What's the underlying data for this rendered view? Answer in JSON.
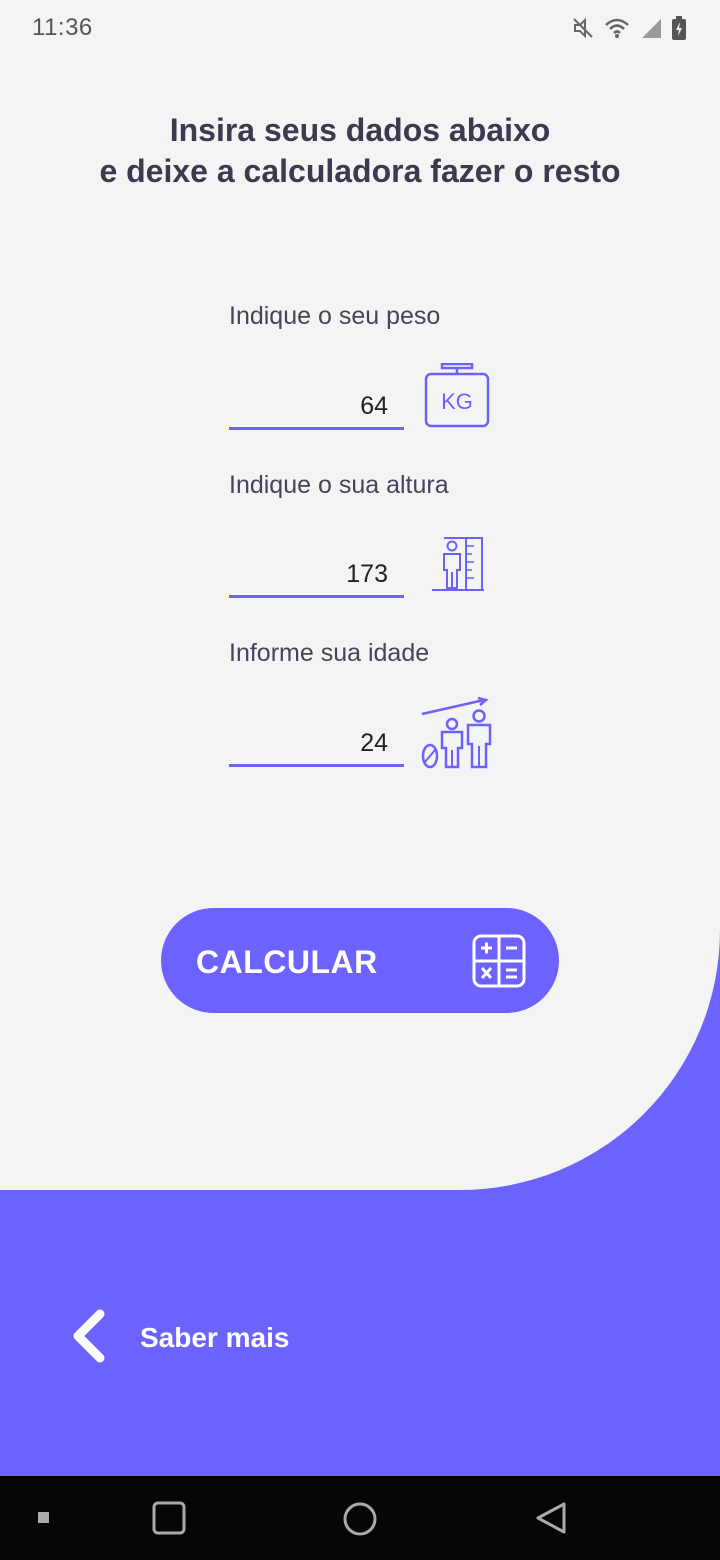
{
  "status_bar": {
    "time": "11:36",
    "icons": [
      "mute-icon",
      "wifi-icon",
      "signal-icon",
      "battery-icon"
    ]
  },
  "heading": {
    "line1": "Insira seus dados abaixo",
    "line2": "e deixe a calculadora fazer o resto"
  },
  "form": {
    "weight": {
      "label": "Indique o seu peso",
      "value": "64",
      "icon": "weight-kg-icon"
    },
    "height": {
      "label": "Indique o sua altura",
      "value": "173",
      "icon": "height-measure-icon"
    },
    "age": {
      "label": "Informe sua idade",
      "value": "24",
      "icon": "age-growth-icon"
    }
  },
  "calculate_button": {
    "label": "CALCULAR",
    "icon": "calculator-icon"
  },
  "footer": {
    "saber_mais_label": "Saber mais",
    "icon": "chevron-left-icon"
  },
  "nav_bar": {
    "icons": [
      "recents-dot-icon",
      "overview-square-icon",
      "home-circle-icon",
      "back-triangle-icon"
    ]
  },
  "colors": {
    "accent": "#6c63ff",
    "background": "#f4f4f4",
    "text": "#3b3a50"
  }
}
